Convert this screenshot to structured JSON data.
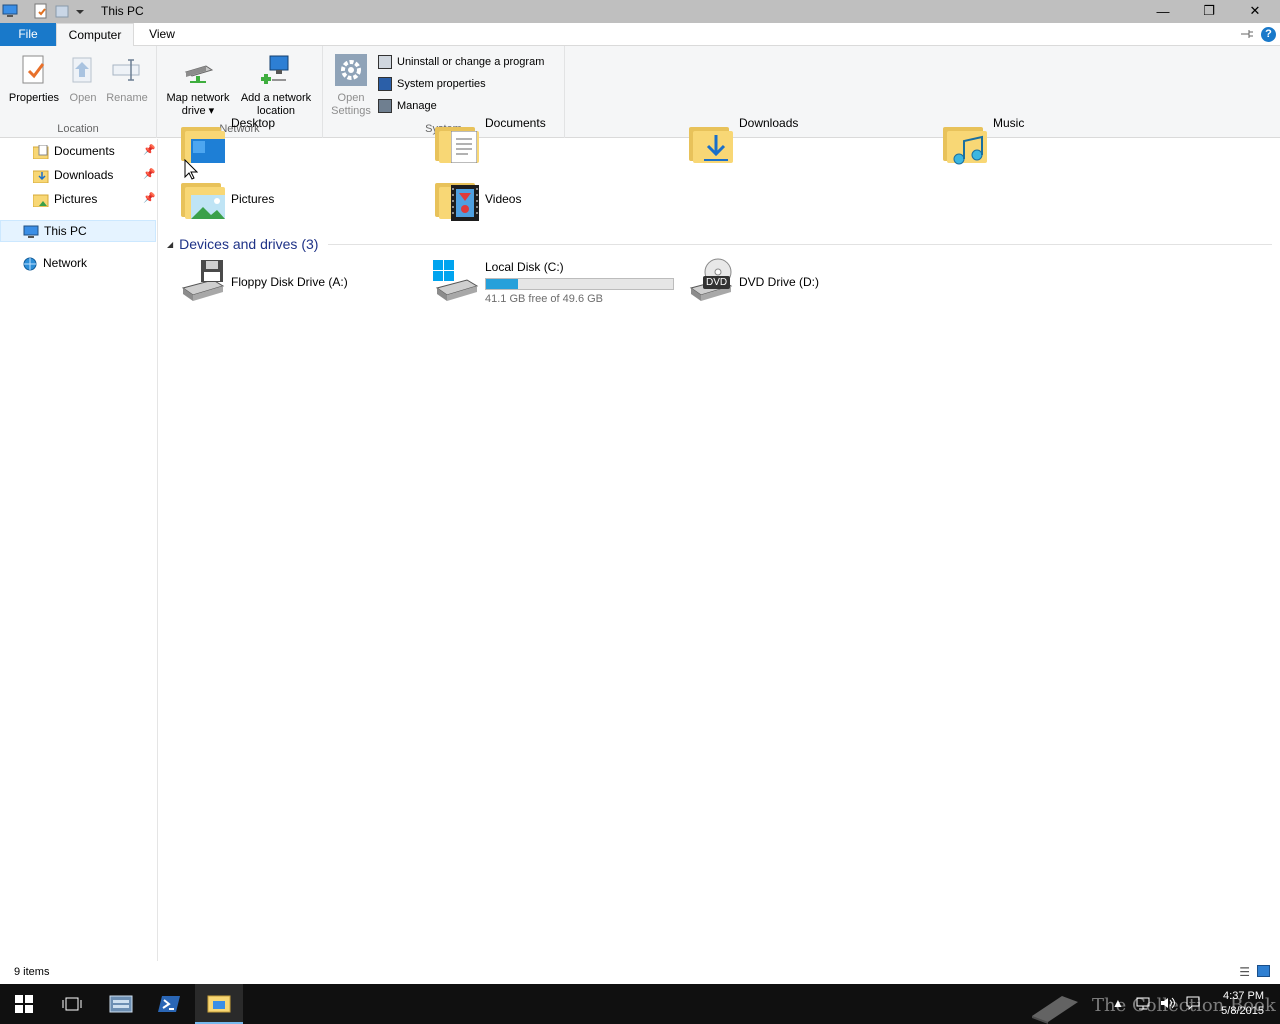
{
  "window": {
    "title": "This PC",
    "controls": {
      "minimize": "—",
      "maximize": "❐",
      "close": "✕"
    }
  },
  "ribbon": {
    "tabs": {
      "file": "File",
      "computer": "Computer",
      "view": "View"
    },
    "help": "?",
    "groups": {
      "location": {
        "label": "Location",
        "properties": "Properties",
        "open": "Open",
        "rename": "Rename"
      },
      "network": {
        "label": "Network",
        "map_line1": "Map network",
        "map_line2": "drive ▾",
        "add_line1": "Add a network",
        "add_line2": "location"
      },
      "system": {
        "label": "System",
        "open_line1": "Open",
        "open_line2": "Settings",
        "uninstall": "Uninstall or change a program",
        "sysprops": "System properties",
        "manage": "Manage"
      }
    }
  },
  "nav": {
    "items": [
      {
        "label": "Documents"
      },
      {
        "label": "Downloads"
      },
      {
        "label": "Pictures"
      },
      {
        "label": "This PC"
      },
      {
        "label": "Network"
      }
    ]
  },
  "folders": [
    {
      "label": "Desktop"
    },
    {
      "label": "Documents"
    },
    {
      "label": "Downloads"
    },
    {
      "label": "Music"
    },
    {
      "label": "Pictures"
    },
    {
      "label": "Videos"
    }
  ],
  "devices": {
    "header": "Devices and drives (3)",
    "floppy": {
      "label": "Floppy Disk Drive (A:)"
    },
    "local": {
      "label": "Local Disk (C:)",
      "free_text": "41.1 GB free of 49.6 GB",
      "used_fraction": 0.171
    },
    "dvd": {
      "label": "DVD Drive (D:)",
      "badge": "DVD"
    }
  },
  "status": {
    "count": "9 items"
  },
  "taskbar": {
    "time": "4:37 PM",
    "date": "5/8/2015",
    "watermark": "The Collection Book"
  },
  "colors": {
    "accent": "#1979ca",
    "drive_fill": "#26a0da",
    "folder": "#f8d775"
  }
}
